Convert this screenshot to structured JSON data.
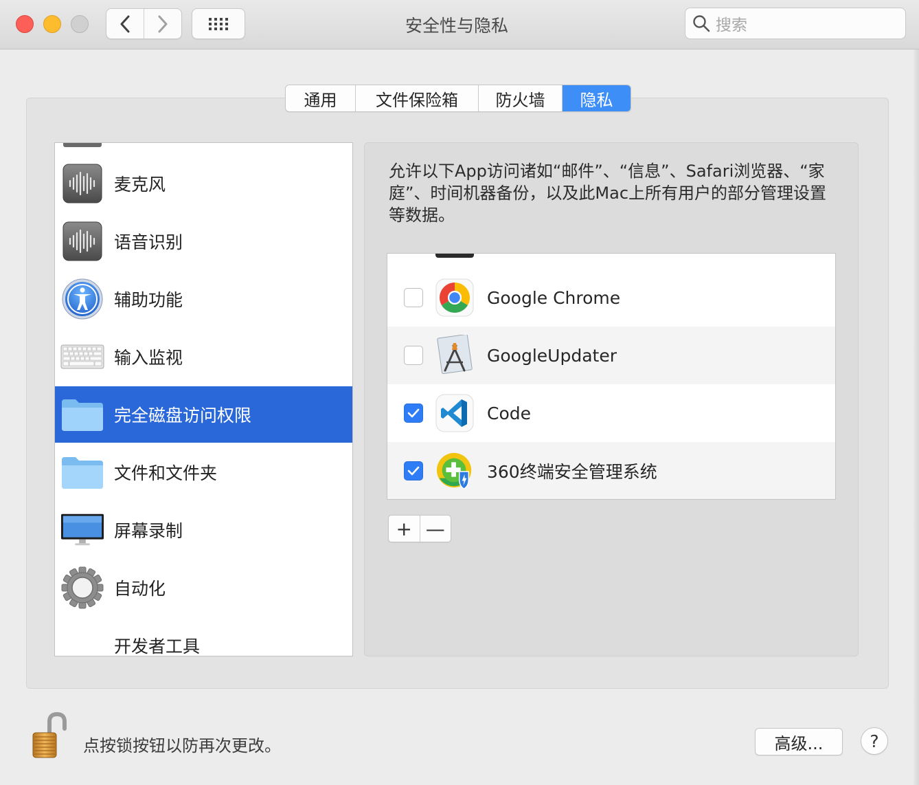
{
  "window": {
    "title": "安全性与隐私",
    "search_placeholder": "搜索"
  },
  "tabs": [
    {
      "label": "通用",
      "active": false
    },
    {
      "label": "文件保险箱",
      "active": false
    },
    {
      "label": "防火墙",
      "active": false
    },
    {
      "label": "隐私",
      "active": true
    }
  ],
  "sidebar": {
    "items": [
      {
        "label": "麦克风",
        "icon": "microphone-icon"
      },
      {
        "label": "语音识别",
        "icon": "speech-recognition-icon"
      },
      {
        "label": "辅助功能",
        "icon": "accessibility-icon"
      },
      {
        "label": "输入监视",
        "icon": "keyboard-icon"
      },
      {
        "label": "完全磁盘访问权限",
        "icon": "folder-icon",
        "selected": true
      },
      {
        "label": "文件和文件夹",
        "icon": "folder-icon"
      },
      {
        "label": "屏幕录制",
        "icon": "display-icon"
      },
      {
        "label": "自动化",
        "icon": "gear-icon"
      },
      {
        "label": "开发者工具",
        "icon": ""
      }
    ]
  },
  "main": {
    "description": "允许以下App访问诸如“邮件”、“信息”、Safari浏览器、“家庭”、时间机器备份，以及此Mac上所有用户的部分管理设置等数据。",
    "apps": [
      {
        "name": "Google Chrome",
        "checked": false,
        "icon": "chrome-icon"
      },
      {
        "name": "GoogleUpdater",
        "checked": false,
        "icon": "app-placeholder-icon"
      },
      {
        "name": "Code",
        "checked": true,
        "icon": "vscode-icon"
      },
      {
        "name": "360终端安全管理系统",
        "checked": true,
        "icon": "360-security-icon"
      }
    ],
    "add_label": "+",
    "remove_label": "—"
  },
  "footer": {
    "lock_text": "点按锁按钮以防再次更改。",
    "advanced_label": "高级...",
    "help_label": "?"
  },
  "colors": {
    "accent": "#3d8ef7",
    "selection": "#2a67d8",
    "checkbox_checked": "#2e7cf6"
  }
}
